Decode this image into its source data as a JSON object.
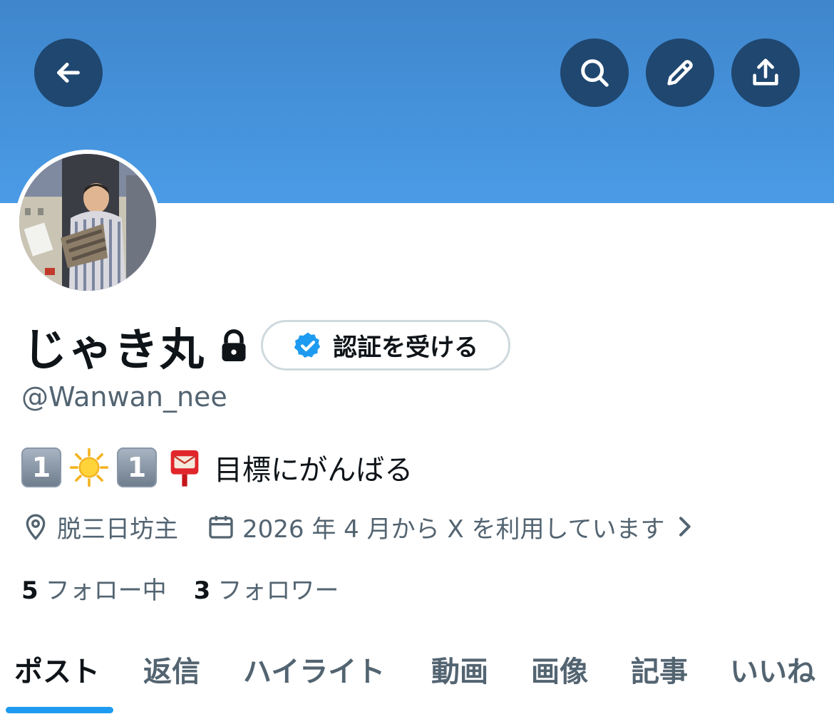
{
  "header": {
    "back_icon": "arrow-left-icon",
    "search_icon": "search-icon",
    "edit_icon": "pencil-icon",
    "share_icon": "share-upload-icon",
    "banner_color": "#4a9be6"
  },
  "profile": {
    "display_name": "じゃき丸",
    "protected_icon": "lock-icon",
    "verify_button_label": "認証を受ける",
    "verify_badge_color": "#1d9bf0",
    "handle": "@Wanwan_nee",
    "bio": {
      "keycap_1": "1",
      "sun_icon": "sun-emoji",
      "keycap_2": "1",
      "postbox_icon": "postbox-emoji",
      "text": "目標にがんばる"
    },
    "location": "脱三日坊主",
    "joined": "2026 年 4 月から X を利用しています",
    "following_count": "5",
    "following_label": "フォロー中",
    "followers_count": "3",
    "followers_label": "フォロワー"
  },
  "tabs": [
    "ポスト",
    "返信",
    "ハイライト",
    "動画",
    "画像",
    "記事",
    "いいね"
  ],
  "active_tab": "ポスト",
  "accent_color": "#1d9bf0"
}
